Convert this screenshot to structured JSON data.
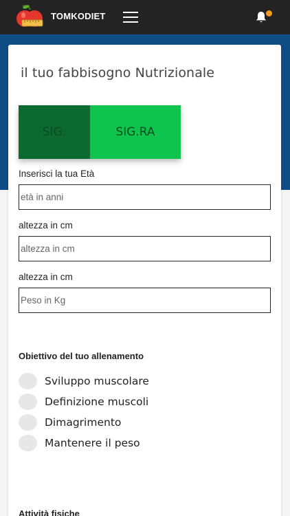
{
  "header": {
    "brand": "TOMKODIET",
    "notification_dot_color": "#f39a1e"
  },
  "form": {
    "title": "il tuo fabbisogno Nutrizionale",
    "gender": {
      "male_label": "SIG.",
      "female_label": "SIG.RA"
    },
    "age": {
      "label": "Inserisci la tua Età",
      "placeholder": "età in anni"
    },
    "height": {
      "label": "altezza in cm",
      "placeholder": "altezza in cm"
    },
    "weight": {
      "label": "altezza in cm",
      "placeholder": "Peso in Kg"
    },
    "goal": {
      "title": "Obiettivo del tuo allenamento",
      "options": [
        "Sviluppo muscolare",
        "Definizione muscoli",
        "Dimagrimento",
        "Mantenere il peso"
      ]
    },
    "activity": {
      "title": "Attività fisiche"
    }
  },
  "colors": {
    "header_bg": "#232323",
    "hero_bg": "#0e4c86",
    "male_btn": "#0c6a2f",
    "female_btn": "#0ec44c"
  }
}
